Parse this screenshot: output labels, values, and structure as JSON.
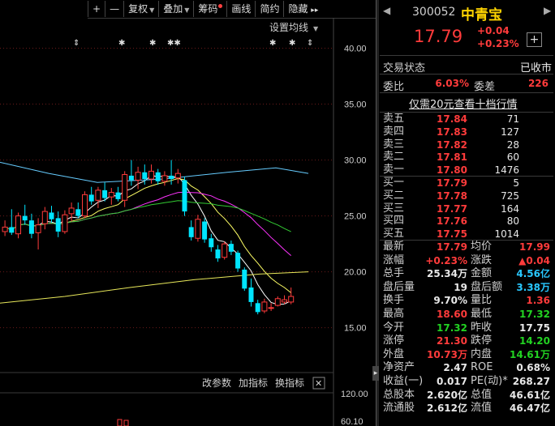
{
  "toolbar": {
    "plus": "+",
    "minus": "—",
    "fuquan": "复权",
    "diejia": "叠加",
    "chouma": "筹码",
    "huaxian": "画线",
    "jianyue": "简约",
    "yincang": "隐藏",
    "more": "▸▸"
  },
  "chart": {
    "settings_ma": "设置均线",
    "price_ticks": [
      "40.00",
      "35.00",
      "30.00",
      "25.00",
      "20.00",
      "15.00"
    ],
    "sub_buttons": {
      "params": "改参数",
      "add_indicator": "加指标",
      "swap_indicator": "换指标",
      "close": "✕"
    },
    "vol_ticks": [
      "120.00",
      "60.10"
    ],
    "markers": [
      "⇕",
      "✱",
      "✱",
      "✱✱",
      "✱",
      "✱",
      "⇕"
    ],
    "colors": {
      "up": "#ff3b3b",
      "down": "#00e5ff",
      "ma_yellow": "#ffff66",
      "ma_white": "#ffffff",
      "ma_magenta": "#ff33ff",
      "ma_green": "#33cc33",
      "ma_cyan": "#66ccff",
      "ma_gold": "#e8e85a"
    }
  },
  "chart_data": {
    "type": "candlestick",
    "ylim": [
      11.5,
      42.5
    ],
    "candles": [
      [
        23.6,
        24.6,
        23.2,
        24.0
      ],
      [
        24.0,
        25.6,
        23.3,
        23.5
      ],
      [
        23.4,
        25.3,
        23.0,
        25.0
      ],
      [
        25.0,
        26.0,
        24.2,
        24.6
      ],
      [
        24.6,
        25.2,
        23.0,
        23.4
      ],
      [
        23.5,
        24.8,
        22.0,
        24.2
      ],
      [
        24.3,
        25.8,
        23.8,
        25.4
      ],
      [
        25.3,
        25.9,
        24.4,
        24.7
      ],
      [
        24.8,
        25.4,
        23.1,
        23.6
      ],
      [
        23.6,
        25.5,
        23.4,
        25.1
      ],
      [
        25.2,
        26.2,
        24.5,
        25.7
      ],
      [
        25.6,
        26.2,
        24.8,
        25.0
      ],
      [
        25.0,
        27.2,
        24.8,
        26.9
      ],
      [
        26.9,
        27.6,
        26.0,
        26.3
      ],
      [
        26.4,
        27.6,
        25.7,
        27.3
      ],
      [
        27.3,
        28.0,
        26.3,
        26.6
      ],
      [
        26.7,
        27.5,
        26.0,
        27.1
      ],
      [
        27.1,
        27.6,
        26.3,
        26.5
      ],
      [
        26.4,
        29.0,
        25.8,
        28.7
      ],
      [
        28.6,
        30.0,
        27.7,
        28.2
      ],
      [
        28.2,
        29.4,
        27.4,
        28.9
      ],
      [
        28.9,
        29.6,
        27.8,
        28.3
      ],
      [
        28.3,
        29.6,
        27.9,
        29.0
      ],
      [
        28.9,
        29.2,
        27.8,
        28.1
      ],
      [
        28.1,
        29.0,
        27.7,
        28.6
      ],
      [
        28.6,
        30.0,
        27.8,
        28.3
      ],
      [
        28.4,
        29.2,
        27.9,
        28.8
      ],
      [
        28.2,
        28.5,
        25.0,
        25.4
      ],
      [
        24.0,
        24.6,
        22.8,
        23.1
      ],
      [
        23.0,
        25.1,
        22.7,
        24.7
      ],
      [
        24.5,
        24.8,
        22.6,
        22.9
      ],
      [
        23.0,
        23.4,
        21.8,
        22.2
      ],
      [
        22.0,
        22.4,
        20.9,
        21.2
      ],
      [
        21.3,
        22.7,
        21.1,
        22.5
      ],
      [
        22.5,
        22.8,
        21.5,
        21.8
      ],
      [
        21.7,
        21.9,
        20.0,
        20.3
      ],
      [
        20.2,
        20.4,
        18.3,
        18.5
      ],
      [
        18.6,
        19.4,
        16.9,
        17.3
      ],
      [
        17.2,
        17.5,
        16.2,
        16.4
      ],
      [
        16.5,
        17.6,
        16.3,
        17.3
      ],
      [
        16.8,
        17.2,
        16.5,
        16.8
      ],
      [
        17.0,
        17.8,
        16.9,
        17.6
      ],
      [
        17.3,
        17.9,
        17.1,
        17.5
      ],
      [
        17.3,
        18.6,
        17.1,
        17.8
      ]
    ]
  },
  "quote": {
    "code": "300052",
    "name": "中青宝",
    "price": "17.79",
    "change": "+0.04",
    "change_pct": "+0.23%",
    "add_btn": "+",
    "status_label": "交易状态",
    "status_value": "已收市",
    "weibi_label": "委比",
    "weibi_value": "6.03%",
    "weicha_label": "委差",
    "weicha_value": "226",
    "ten_levels_link": "仅需20元查看十档行情",
    "asks": [
      {
        "label": "卖五",
        "price": "17.84",
        "vol": "71"
      },
      {
        "label": "卖四",
        "price": "17.83",
        "vol": "127"
      },
      {
        "label": "卖三",
        "price": "17.82",
        "vol": "28"
      },
      {
        "label": "卖二",
        "price": "17.81",
        "vol": "60"
      },
      {
        "label": "卖一",
        "price": "17.80",
        "vol": "1476"
      }
    ],
    "bids": [
      {
        "label": "买一",
        "price": "17.79",
        "vol": "5"
      },
      {
        "label": "买二",
        "price": "17.78",
        "vol": "725"
      },
      {
        "label": "买三",
        "price": "17.77",
        "vol": "164"
      },
      {
        "label": "买四",
        "price": "17.76",
        "vol": "80"
      },
      {
        "label": "买五",
        "price": "17.75",
        "vol": "1014"
      }
    ],
    "stats": [
      {
        "l1": "最新",
        "v1": "17.79",
        "c1": "red",
        "l2": "均价",
        "v2": "17.99",
        "c2": "red"
      },
      {
        "l1": "涨幅",
        "v1": "+0.23%",
        "c1": "red",
        "l2": "涨跌",
        "v2": "▲0.04",
        "c2": "red"
      },
      {
        "l1": "总手",
        "v1": "25.34万",
        "c1": "white",
        "l2": "金额",
        "v2": "4.56亿",
        "c2": "cyan"
      },
      {
        "l1": "盘后量",
        "v1": "19",
        "c1": "white",
        "l2": "盘后额",
        "v2": "3.38万",
        "c2": "cyan"
      },
      {
        "l1": "换手",
        "v1": "9.70%",
        "c1": "white",
        "l2": "量比",
        "v2": "1.36",
        "c2": "red"
      },
      {
        "l1": "最高",
        "v1": "18.60",
        "c1": "red",
        "l2": "最低",
        "v2": "17.32",
        "c2": "green"
      },
      {
        "l1": "今开",
        "v1": "17.32",
        "c1": "green",
        "l2": "昨收",
        "v2": "17.75",
        "c2": "white"
      },
      {
        "l1": "涨停",
        "v1": "21.30",
        "c1": "red",
        "l2": "跌停",
        "v2": "14.20",
        "c2": "green"
      },
      {
        "l1": "外盘",
        "v1": "10.73万",
        "c1": "red",
        "l2": "内盘",
        "v2": "14.61万",
        "c2": "green"
      },
      {
        "l1": "净资产",
        "v1": "2.47",
        "c1": "white",
        "l2": "ROE",
        "v2": "0.68%",
        "c2": "white"
      },
      {
        "l1": "收益(一)",
        "v1": "0.017",
        "c1": "white",
        "l2": "PE(动)*",
        "v2": "268.27",
        "c2": "white"
      },
      {
        "l1": "总股本",
        "v1": "2.620亿",
        "c1": "white",
        "l2": "总值",
        "v2": "46.61亿",
        "c2": "white"
      },
      {
        "l1": "流通股",
        "v1": "2.612亿",
        "c1": "white",
        "l2": "流值",
        "v2": "46.47亿",
        "c2": "white"
      }
    ]
  }
}
